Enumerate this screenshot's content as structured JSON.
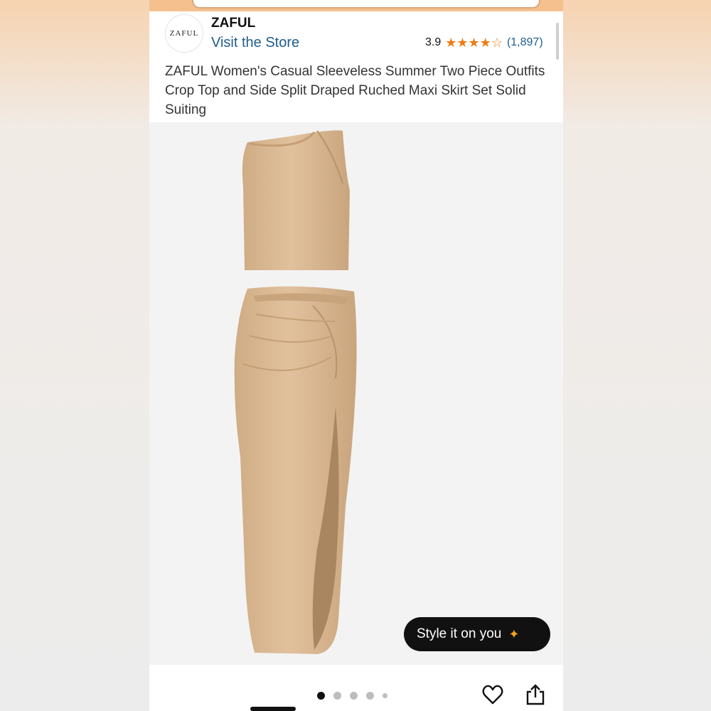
{
  "header": {
    "brand_logo_text": "ZAFUL",
    "brand_name": "ZAFUL",
    "visit_store_label": "Visit the Store",
    "rating_value": "3.9",
    "rating_stars": 3.9,
    "review_count": "(1,897)"
  },
  "product": {
    "title": "ZAFUL Women's Casual Sleeveless Summer Two Piece Outfits Crop Top and Side Split Draped Ruched Maxi Skirt Set Solid Suiting"
  },
  "image_gallery": {
    "current_index": 1,
    "total": 5,
    "style_button_label": "Style it on you"
  },
  "actions": {
    "favorite_icon": "heart-icon",
    "share_icon": "share-icon"
  },
  "colors": {
    "accent_star": "#ef7b14",
    "link": "#1f5d8c",
    "product_fabric": "#dcbb95"
  }
}
